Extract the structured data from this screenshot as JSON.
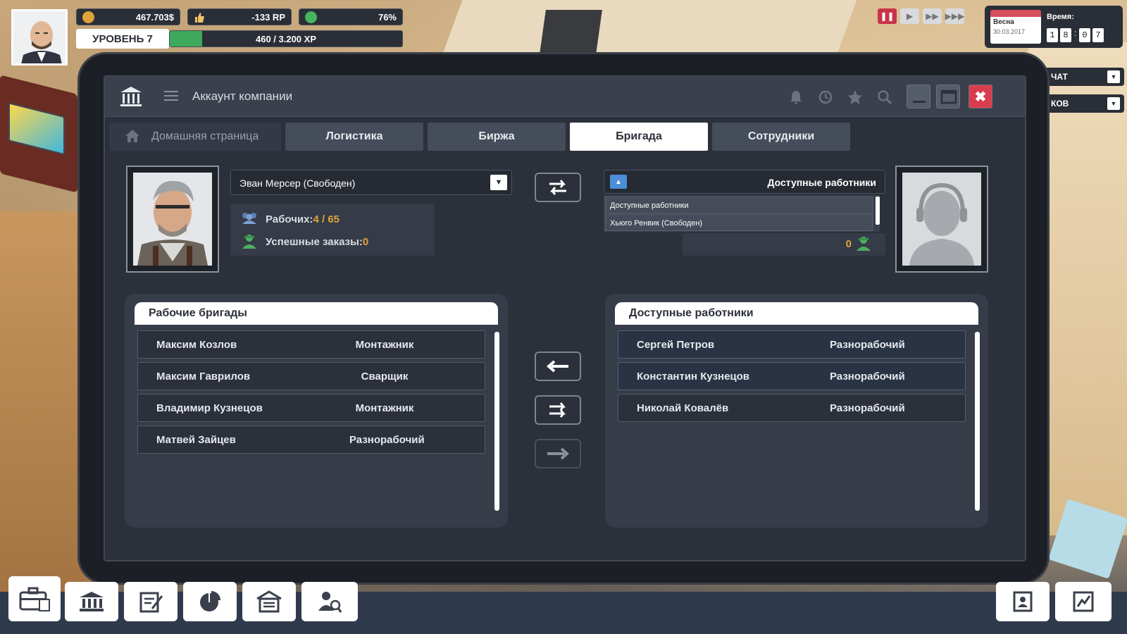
{
  "hud": {
    "money": "467.703$",
    "reputation": "-133 RP",
    "happiness": "76%",
    "level": "УРОВЕНЬ 7",
    "xp_text": "460 / 3.200 XP",
    "xp_progress": 0.14
  },
  "calendar": {
    "season": "Весна",
    "date": "30.03.2017",
    "time_label": "Время:",
    "digits": [
      "1",
      "8",
      "0",
      "7"
    ]
  },
  "side_dropdowns": [
    "ЧАТ",
    "КОВ"
  ],
  "window": {
    "title": "Аккаунт компании",
    "tabs": {
      "home": "Домашняя страница",
      "logistics": "Логистика",
      "exchange": "Биржа",
      "brigade": "Бригада",
      "employees": "Сотрудники"
    }
  },
  "foreman": {
    "selected": "Эван Мерсер (Свободен)",
    "workers_label": "Рабочих:",
    "workers_value": "4 / 65",
    "orders_label": "Успешные заказы:",
    "orders_value": "0"
  },
  "available_dropdown": {
    "label": "Доступные работники",
    "items": [
      "Доступные работники",
      "Хьюго Ренвик (Свободен)"
    ],
    "orders_value": "0"
  },
  "left_panel": {
    "title": "Рабочие бригады",
    "rows": [
      {
        "name": "Максим Козлов",
        "role": "Монтажник"
      },
      {
        "name": "Максим Гаврилов",
        "role": "Сварщик"
      },
      {
        "name": "Владимир Кузнецов",
        "role": "Монтажник"
      },
      {
        "name": "Матвей Зайцев",
        "role": "Разнорабочий"
      }
    ]
  },
  "right_panel": {
    "title": "Доступные работники",
    "rows": [
      {
        "name": "Сергей Петров",
        "role": "Разнорабочий"
      },
      {
        "name": "Константин Кузнецов",
        "role": "Разнорабочий"
      },
      {
        "name": "Николай Ковалёв",
        "role": "Разнорабочий"
      }
    ]
  },
  "colors": {
    "accent_orange": "#e0a33b",
    "close_red": "#d93d4d",
    "xp_green": "#3ea95a",
    "pause_red": "#c9344b"
  },
  "icons": {
    "money": "coin-icon",
    "reputation": "thumbs-up-icon",
    "happiness": "smiley-icon",
    "bottom": [
      "briefcase-icon",
      "bank-icon",
      "contract-icon",
      "pie-chart-icon",
      "warehouse-icon",
      "worker-search-icon",
      "employee-card-icon",
      "stats-icon"
    ]
  }
}
